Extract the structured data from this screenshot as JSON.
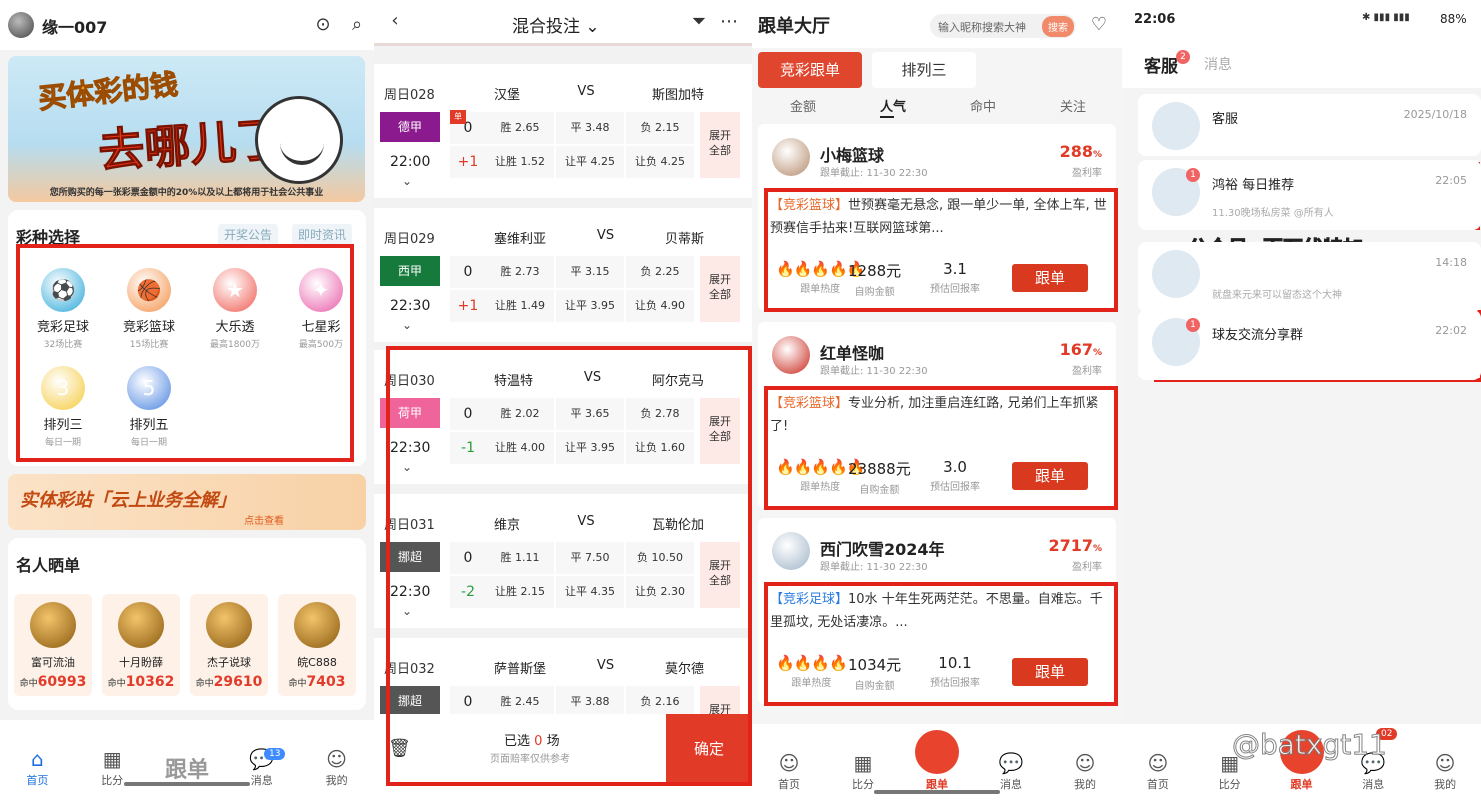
{
  "p1": {
    "username": "缘一007",
    "banner": {
      "line1": "买体彩的钱",
      "line2": "去哪儿了?",
      "foot": "您所购买的每一张彩票金额中的20%以及以上都将用于社会公共事业"
    },
    "lottery": {
      "title": "彩种选择",
      "links": [
        "开奖公告",
        "即时资讯"
      ],
      "items": [
        {
          "name": "竞彩足球",
          "sub": "32场比赛",
          "color": "#29a7d8",
          "glyph": "⚽"
        },
        {
          "name": "竞彩篮球",
          "sub": "15场比赛",
          "color": "#f39046",
          "glyph": "🏀"
        },
        {
          "name": "大乐透",
          "sub": "最高1800万",
          "color": "#ef5a50",
          "glyph": "★"
        },
        {
          "name": "七星彩",
          "sub": "最高500万",
          "color": "#e85aa7",
          "glyph": "✦"
        },
        {
          "name": "排列三",
          "sub": "每日一期",
          "color": "#f5c93a",
          "glyph": "3"
        },
        {
          "name": "排列五",
          "sub": "每日一期",
          "color": "#4a84e0",
          "glyph": "5"
        }
      ]
    },
    "promo": {
      "title": "实体彩站「云上业务全解」",
      "sub": "点击查看"
    },
    "celebs": {
      "title": "名人晒单",
      "hit_label": "命中",
      "items": [
        {
          "name": "富可流油",
          "hit": "60993"
        },
        {
          "name": "十月盼薛",
          "hit": "10362"
        },
        {
          "name": "杰子说球",
          "hit": "29610"
        },
        {
          "name": "皖C888",
          "hit": "7403"
        }
      ]
    },
    "tabs": [
      {
        "label": "首页",
        "icon": "⌂"
      },
      {
        "label": "比分",
        "icon": "▦"
      },
      {
        "label": "跟单",
        "icon": ""
      },
      {
        "label": "消息",
        "icon": "💬"
      },
      {
        "label": "我的",
        "icon": "☺"
      }
    ],
    "msg_badge": "13"
  },
  "p2": {
    "title": "混合投注",
    "vs": "VS",
    "expand": [
      "展开",
      "全部"
    ],
    "single": "单",
    "matches": [
      {
        "day": "周日028",
        "home": "汉堡",
        "away": "斯图加特",
        "league": "德甲",
        "lcolor": "#8b1a8f",
        "time": "22:00",
        "h1": "0",
        "h2": "+1",
        "o": [
          "胜 2.65",
          "平 3.48",
          "负 2.15",
          "让胜 1.52",
          "让平 4.25",
          "让负 4.25"
        ]
      },
      {
        "day": "周日029",
        "home": "塞维利亚",
        "away": "贝蒂斯",
        "league": "西甲",
        "lcolor": "#157a3c",
        "time": "22:30",
        "h1": "0",
        "h2": "+1",
        "o": [
          "胜 2.73",
          "平 3.15",
          "负 2.25",
          "让胜 1.49",
          "让平 3.95",
          "让负 4.90"
        ]
      },
      {
        "day": "周日030",
        "home": "特温特",
        "away": "阿尔克马",
        "league": "荷甲",
        "lcolor": "#f0649c",
        "time": "22:30",
        "h1": "0",
        "h2": "-1",
        "o": [
          "胜 2.02",
          "平 3.65",
          "负 2.78",
          "让胜 4.00",
          "让平 3.95",
          "让负 1.60"
        ]
      },
      {
        "day": "周日031",
        "home": "维京",
        "away": "瓦勒伦加",
        "league": "挪超",
        "lcolor": "#555555",
        "time": "22:30",
        "h1": "0",
        "h2": "-2",
        "o": [
          "胜 1.11",
          "平 7.50",
          "负 10.50",
          "让胜 2.15",
          "让平 4.35",
          "让负 2.30"
        ]
      },
      {
        "day": "周日032",
        "home": "萨普斯堡",
        "away": "莫尔德",
        "league": "挪超",
        "lcolor": "#555555",
        "time": "",
        "h1": "0",
        "h2": "",
        "o": [
          "胜 2.45",
          "平 3.88",
          "负 2.16",
          "",
          "",
          ""
        ]
      }
    ],
    "bottom": {
      "selected_pre": "已选",
      "selected_count": "0",
      "selected_post": "场",
      "note": "页面赔率仅供参考",
      "confirm": "确定"
    }
  },
  "p3": {
    "title": "跟单大厅",
    "search_placeholder": "输入昵称搜索大神",
    "search_btn": "搜索",
    "segs": [
      "竞彩跟单",
      "排列三"
    ],
    "subtabs": [
      "金额",
      "人气",
      "命中",
      "关注"
    ],
    "deadline_label": "跟单截止: 11-30 22:30",
    "profit_label": "盈利率",
    "stat_labels": [
      "跟单热度",
      "自购金额",
      "预估回报率"
    ],
    "follow": "跟单",
    "posts": [
      {
        "name": "小梅篮球",
        "pct": "288",
        "pct_unit": "%",
        "tag": "【竞彩篮球】",
        "text": "世预赛毫无悬念, 跟一单少一单, 全体上车, 世预赛信手拈来!互联网篮球第...",
        "flames": "🔥🔥🔥🔥🔥",
        "amount": "1288元",
        "ret": "3.1",
        "av": "#b58a6a"
      },
      {
        "name": "红单怪咖",
        "pct": "167",
        "pct_unit": "%",
        "tag": "【竞彩篮球】",
        "text": "专业分析, 加注重启连红路, 兄弟们上车抓紧了!",
        "flames": "🔥🔥🔥🔥🔥",
        "amount": "23888元",
        "ret": "3.0",
        "av": "#c8261a"
      },
      {
        "name": "西门吹雪2024年",
        "pct": "2717",
        "pct_unit": "%",
        "tag": "【竞彩足球】",
        "text": "10水 十年生死两茫茫。不思量。自难忘。千里孤坟, 无处话凄凉。...",
        "flames": "🔥🔥🔥🔥",
        "amount": "1034元",
        "ret": "10.1",
        "av": "#9fb4c8"
      }
    ],
    "tabs": [
      {
        "label": "首页",
        "icon": "☺"
      },
      {
        "label": "比分",
        "icon": "▦"
      },
      {
        "label": "跟单",
        "icon": ""
      },
      {
        "label": "消息",
        "icon": "💬"
      },
      {
        "label": "我的",
        "icon": "☺"
      }
    ]
  },
  "p4": {
    "status_time": "22:06",
    "status_right": "88%",
    "tab_service": "客服",
    "tab_service_badge": "2",
    "tab_msg": "消息",
    "chats": [
      {
        "name": "客服",
        "time": "2025/10/18",
        "sub": "",
        "dot": ""
      },
      {
        "name": "鸿裕 每日推荐",
        "time": "22:05",
        "sub": "11.30晚场私房菜 @所有人",
        "dot": "1"
      },
      {
        "name": "",
        "time": "14:18",
        "sub": "就盘来元来可以留态这个大神",
        "dot": ""
      },
      {
        "name": "球友交流分享群",
        "time": "22:02",
        "sub": "",
        "dot": "1"
      }
    ],
    "overlay": "公众号: 百万伏特加",
    "watermark": "@batxgt11",
    "tabs": [
      {
        "label": "首页",
        "icon": "☺"
      },
      {
        "label": "比分",
        "icon": "▦"
      },
      {
        "label": "跟单",
        "icon": ""
      },
      {
        "label": "消息",
        "icon": "💬"
      },
      {
        "label": "我的",
        "icon": "☺"
      }
    ],
    "msg_badge": "02"
  }
}
